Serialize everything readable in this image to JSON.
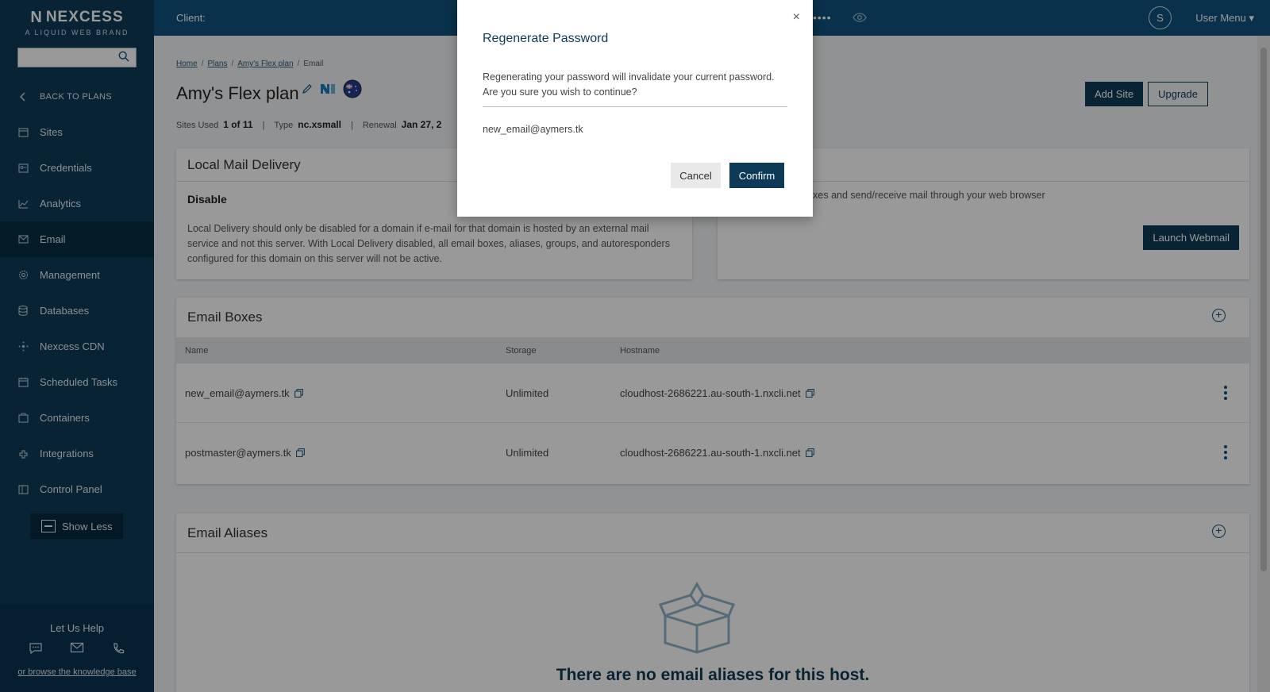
{
  "sidebar": {
    "logo_main": "NEXCESS",
    "logo_sub": "A LIQUID WEB BRAND",
    "back_label": "BACK TO PLANS",
    "items": [
      {
        "label": "Sites",
        "icon": "sites-icon"
      },
      {
        "label": "Credentials",
        "icon": "credentials-icon"
      },
      {
        "label": "Analytics",
        "icon": "analytics-icon"
      },
      {
        "label": "Email",
        "icon": "email-icon"
      },
      {
        "label": "Management",
        "icon": "gear-icon"
      },
      {
        "label": "Databases",
        "icon": "database-icon"
      },
      {
        "label": "Nexcess CDN",
        "icon": "cdn-icon"
      },
      {
        "label": "Scheduled Tasks",
        "icon": "calendar-icon"
      },
      {
        "label": "Containers",
        "icon": "container-icon"
      },
      {
        "label": "Integrations",
        "icon": "integrations-icon"
      },
      {
        "label": "Control Panel",
        "icon": "control-panel-icon"
      }
    ],
    "show_less": "Show Less",
    "help_title": "Let Us Help",
    "help_link": "or browse the knowledge base"
  },
  "topbar": {
    "client_label": "Client:",
    "masked": "••••",
    "avatar_initial": "S",
    "user_menu": "User Menu ▾"
  },
  "breadcrumb": {
    "home": "Home",
    "plans": "Plans",
    "plan": "Amy's Flex plan",
    "current": "Email"
  },
  "plan": {
    "title": "Amy's Flex plan",
    "sites_used_label": "Sites Used",
    "sites_used": "1 of 11",
    "type_label": "Type",
    "type": "nc.xsmall",
    "renewal_label": "Renewal",
    "renewal": "Jan 27, 2",
    "add_site": "Add Site",
    "upgrade": "Upgrade"
  },
  "local_mail": {
    "title": "Local Mail Delivery",
    "subtitle": "Disable",
    "description": "Local Delivery should only be disabled for a domain if e-mail for that domain is hosted by an external mail service and not this server. With Local Delivery disabled, all email boxes, aliases, groups, and autoresponders configured for this domain on this server will not be active."
  },
  "webmail": {
    "description": "l boxes and send/receive mail through your web browser",
    "launch": "Launch Webmail"
  },
  "email_boxes": {
    "title": "Email Boxes",
    "columns": [
      "Name",
      "Storage",
      "Hostname"
    ],
    "rows": [
      {
        "name": "new_email@aymers.tk",
        "storage": "Unlimited",
        "hostname": "cloudhost-2686221.au-south-1.nxcli.net"
      },
      {
        "name": "postmaster@aymers.tk",
        "storage": "Unlimited",
        "hostname": "cloudhost-2686221.au-south-1.nxcli.net"
      }
    ]
  },
  "email_aliases": {
    "title": "Email Aliases",
    "empty": "There are no email aliases for this host."
  },
  "modal": {
    "title": "Regenerate Password",
    "body": "Regenerating your password will invalidate your current password. Are you sure you wish to continue?",
    "email": "new_email@aymers.tk",
    "cancel": "Cancel",
    "confirm": "Confirm",
    "close": "×"
  },
  "colors": {
    "sidebar_bg": "#0d3b57",
    "topbar_bg": "#10527d",
    "primary": "#0d3b57"
  }
}
